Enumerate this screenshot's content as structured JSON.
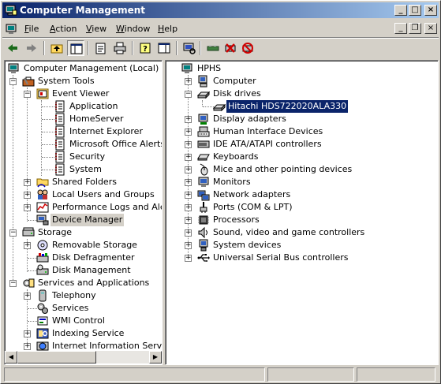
{
  "window": {
    "title": "Computer Management",
    "title_icon": "computer-management-icon"
  },
  "menu": {
    "items": [
      "File",
      "Action",
      "View",
      "Window",
      "Help"
    ],
    "mnemonics": [
      "F",
      "A",
      "V",
      "W",
      "H"
    ]
  },
  "toolbar": {
    "buttons": [
      "back-icon",
      "forward-icon",
      "up-one-level-icon",
      "show-hide-tree-icon",
      "properties-icon",
      "print-icon",
      "help-icon",
      "show-hide-action-pane-icon",
      "scan-hardware-icon",
      "update-driver-icon",
      "uninstall-icon",
      "disable-icon"
    ]
  },
  "tree": {
    "root": "Computer Management (Local)",
    "system_tools": "System Tools",
    "event_viewer": "Event Viewer",
    "event_logs": [
      "Application",
      "HomeServer",
      "Internet Explorer",
      "Microsoft Office Alerts",
      "Security",
      "System"
    ],
    "shared_folders": "Shared Folders",
    "local_users": "Local Users and Groups",
    "perf_logs": "Performance Logs and Alerts",
    "device_manager": "Device Manager",
    "storage": "Storage",
    "storage_items": [
      "Removable Storage",
      "Disk Defragmenter",
      "Disk Management"
    ],
    "services_apps": "Services and Applications",
    "services_items": [
      "Telephony",
      "Services",
      "WMI Control",
      "Indexing Service",
      "Internet Information Services"
    ]
  },
  "devices": {
    "root": "HPHS",
    "categories": [
      "Computer",
      "Disk drives",
      "Display adapters",
      "Human Interface Devices",
      "IDE ATA/ATAPI controllers",
      "Keyboards",
      "Mice and other pointing devices",
      "Monitors",
      "Network adapters",
      "Ports (COM & LPT)",
      "Processors",
      "Sound, video and game controllers",
      "System devices",
      "Universal Serial Bus controllers"
    ],
    "disk_child": "Hitachi HDS722020ALA330"
  }
}
